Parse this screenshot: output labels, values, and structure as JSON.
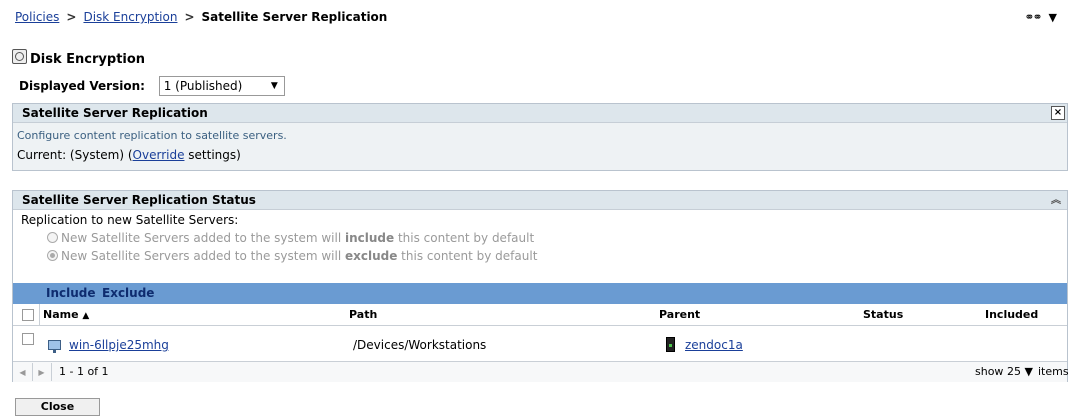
{
  "breadcrumb": {
    "items": [
      "Policies",
      "Disk Encryption"
    ],
    "separator": ">",
    "current": "Satellite Server Replication"
  },
  "topright": {
    "link_icon": "link-icon",
    "menu_arrow": "▼"
  },
  "page": {
    "title": "Disk Encryption",
    "icon": "policy-icon"
  },
  "version": {
    "label": "Displayed Version:",
    "value": "1 (Published)"
  },
  "panel1": {
    "title": "Satellite Server Replication",
    "close": "×",
    "description": "Configure content replication to satellite servers.",
    "current_prefix": "Current:  (System)  (",
    "override_link": "Override",
    "current_suffix": " settings)"
  },
  "panel2": {
    "title": "Satellite Server Replication Status",
    "collapse": "«",
    "replication_label": "Replication to new Satellite Servers:",
    "option1_pre": "New Satellite Servers added to the system will ",
    "option1_bold": "include",
    "option1_post": " this content by default",
    "option2_pre": "New Satellite Servers added to the system will ",
    "option2_bold": "exclude",
    "option2_post": " this content by default",
    "selected_option": 2
  },
  "actions": {
    "include": "Include",
    "exclude": "Exclude"
  },
  "table": {
    "columns": {
      "name": "Name",
      "sort": "▲",
      "path": "Path",
      "parent": "Parent",
      "status": "Status",
      "included": "Included"
    },
    "rows": [
      {
        "name": "win-6llpje25mhg",
        "path": "/Devices/Workstations",
        "parent": "zendoc1a",
        "status": "",
        "included": ""
      }
    ]
  },
  "pager": {
    "range": "1 - 1 of 1",
    "show": "show",
    "count": "25 ▼",
    "items": "items"
  },
  "buttons": {
    "close": "Close"
  },
  "colors": {
    "action_bar": "#6a9bd2",
    "panel_header": "#dde6ec",
    "link": "#1a3f99"
  }
}
